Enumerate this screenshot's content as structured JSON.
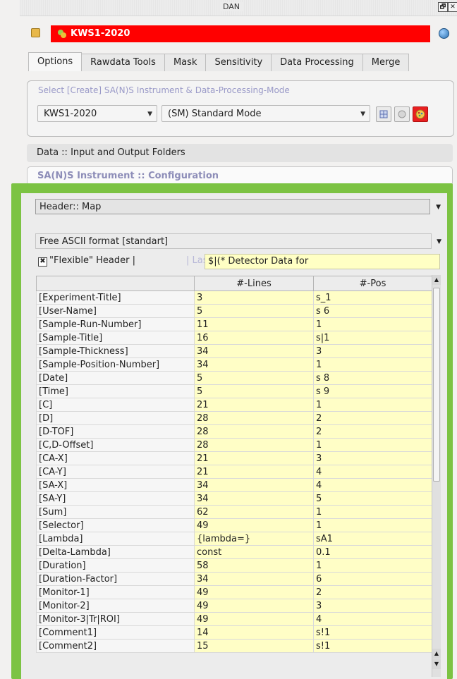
{
  "window": {
    "title": "DAN",
    "restore_glyph": "🗗",
    "close_glyph": "✕"
  },
  "instrument_bar": {
    "name": "KWS1-2020"
  },
  "tabs": [
    {
      "label": "Options",
      "active": true
    },
    {
      "label": "Rawdata Tools"
    },
    {
      "label": "Mask"
    },
    {
      "label": "Sensitivity"
    },
    {
      "label": "Data Processing"
    },
    {
      "label": "Merge"
    }
  ],
  "select_group": {
    "legend": "Select [Create] SA(N)S Instrument & Data-Processing-Mode",
    "instrument_value": "KWS1-2020",
    "mode_value": "(SM) Standard Mode"
  },
  "sections": {
    "data_folders": "Data :: Input and Output Folders",
    "instrument_config": "SA(N)S Instrument :: Configuration"
  },
  "header_map": {
    "combo_label": "Header:: Map",
    "format_label": "Free ASCII format [standart]",
    "flexible_label": "\"Flexible\" Header |",
    "last_line_label": "| Last Line ::",
    "last_line_value": "$|(* Detector Data for"
  },
  "table": {
    "columns": [
      "",
      "#-Lines",
      "#-Pos"
    ],
    "rows": [
      [
        "[Experiment-Title]",
        "3",
        "s_1"
      ],
      [
        "[User-Name]",
        "5",
        "s 6"
      ],
      [
        "[Sample-Run-Number]",
        "11",
        "1"
      ],
      [
        "[Sample-Title]",
        "16",
        "s|1"
      ],
      [
        "[Sample-Thickness]",
        "34",
        "3"
      ],
      [
        "[Sample-Position-Number]",
        "34",
        "1"
      ],
      [
        "[Date]",
        "5",
        "s 8"
      ],
      [
        "[Time]",
        "5",
        "s 9"
      ],
      [
        "[C]",
        "21",
        "1"
      ],
      [
        "[D]",
        "28",
        "2"
      ],
      [
        "[D-TOF]",
        "28",
        "2"
      ],
      [
        "[C,D-Offset]",
        "28",
        "1"
      ],
      [
        "[CA-X]",
        "21",
        "3"
      ],
      [
        "[CA-Y]",
        "21",
        "4"
      ],
      [
        "[SA-X]",
        "34",
        "4"
      ],
      [
        "[SA-Y]",
        "34",
        "5"
      ],
      [
        "[Sum]",
        "62",
        "1"
      ],
      [
        "[Selector]",
        "49",
        "1"
      ],
      [
        "[Lambda]",
        "{lambda=}",
        "sA1"
      ],
      [
        "[Delta-Lambda]",
        "const",
        "0.1"
      ],
      [
        "[Duration]",
        "58",
        "1"
      ],
      [
        "[Duration-Factor]",
        "34",
        "6"
      ],
      [
        "[Monitor-1]",
        "49",
        "2"
      ],
      [
        "[Monitor-2]",
        "49",
        "3"
      ],
      [
        "[Monitor-3|Tr|ROI]",
        "49",
        "4"
      ],
      [
        "[Comment1]",
        "14",
        "s!1"
      ],
      [
        "[Comment2]",
        "15",
        "s!1"
      ]
    ]
  }
}
